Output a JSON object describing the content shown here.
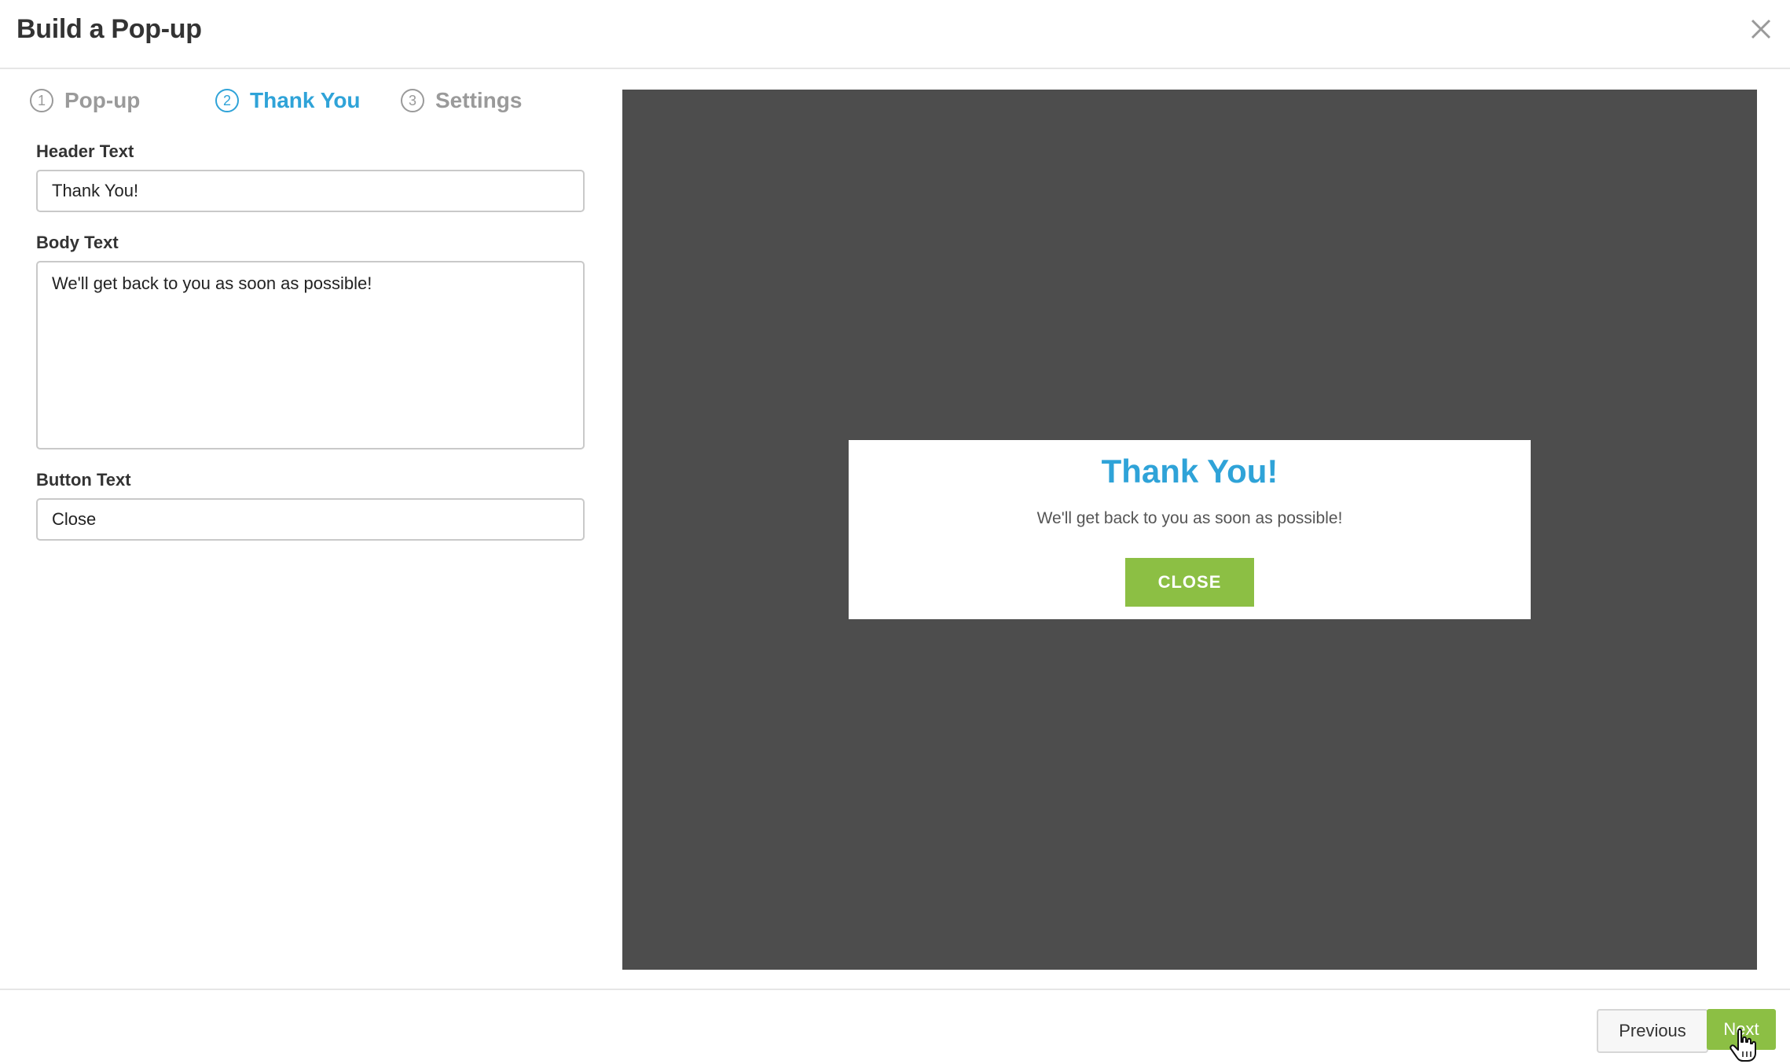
{
  "header": {
    "title": "Build a Pop-up",
    "close_icon": "close-icon"
  },
  "steps": [
    {
      "number": "1",
      "label": "Pop-up",
      "active": false
    },
    {
      "number": "2",
      "label": "Thank You",
      "active": true
    },
    {
      "number": "3",
      "label": "Settings",
      "active": false
    }
  ],
  "form": {
    "header_text": {
      "label": "Header Text",
      "value": "Thank You!"
    },
    "body_text": {
      "label": "Body Text",
      "value": "We'll get back to you as soon as possible!"
    },
    "button_text": {
      "label": "Button Text",
      "value": "Close"
    }
  },
  "preview": {
    "title": "Thank You!",
    "body": "We'll get back to you as soon as possible!",
    "button": "CLOSE"
  },
  "footer": {
    "previous_label": "Previous",
    "next_label": "Next"
  },
  "colors": {
    "accent_blue": "#2fa3d8",
    "accent_green": "#8cbf44",
    "preview_bg": "#4d4d4d"
  }
}
